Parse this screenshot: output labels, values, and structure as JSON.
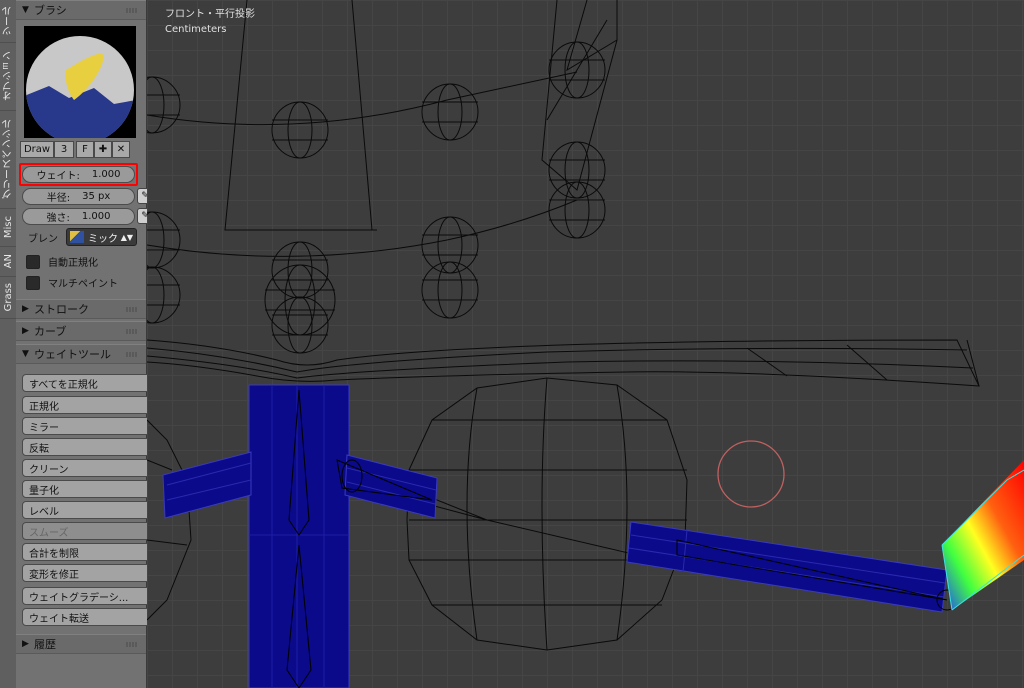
{
  "tool_tabs": [
    "ツール",
    "オプション",
    "グリースペンシル",
    "Misc",
    "AN",
    "Grass"
  ],
  "brush_panel": {
    "title": "ブラシ",
    "brush_name": "Draw",
    "users": "3",
    "fake_user": "F",
    "weight_label": "ウェイト:",
    "weight_value": "1.000",
    "radius_label": "半径:",
    "radius_value": "35 px",
    "strength_label": "強さ:",
    "strength_value": "1.000",
    "blend_label": "ブレン",
    "blend_value": "ミック",
    "auto_normalize_label": "自動正規化",
    "multipaint_label": "マルチペイント"
  },
  "sections": {
    "stroke": "ストローク",
    "curve": "カーブ",
    "weight_tools": "ウェイトツール",
    "history": "履歴"
  },
  "weight_tools": [
    "すべてを正規化",
    "正規化",
    "ミラー",
    "反転",
    "クリーン",
    "量子化",
    "レベル",
    "スムーズ",
    "合計を制限",
    "変形を修正",
    "ウェイトグラデーシ...",
    "ウェイト転送"
  ],
  "viewport": {
    "view_name": "フロント・平行投影",
    "units": "Centimeters"
  },
  "colors": {
    "highlight": "#ff0000",
    "weight_blue": "#0a0a8a",
    "brush_circle": "#c06060"
  }
}
